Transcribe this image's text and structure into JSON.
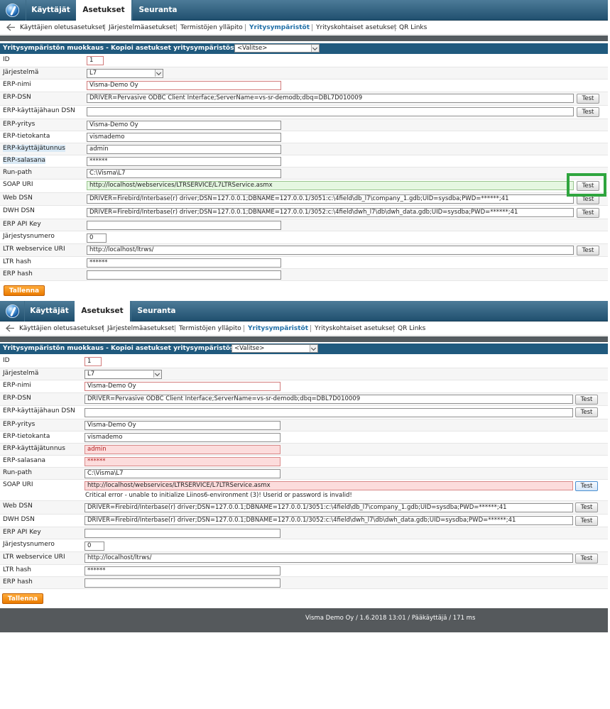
{
  "nav": {
    "tabs": [
      "Käyttäjät",
      "Asetukset",
      "Seuranta"
    ],
    "active_tab": "Asetukset"
  },
  "subnav": {
    "items": [
      "Käyttäjien oletusasetukset",
      "Järjestelmäasetukset",
      "Termistöjen ylläpito",
      "Yritysympäristöt",
      "Yrityskohtaiset asetukset",
      "QR Links"
    ],
    "active": "Yritysympäristöt"
  },
  "form": {
    "header": "Yritysympäristön muokkaus - Kopioi asetukset yritysympäristöstä:",
    "copy_select": "<Valitse>",
    "labels": {
      "id": "ID",
      "jarjestelma": "Järjestelmä",
      "erp_nimi": "ERP-nimi",
      "erp_dsn": "ERP-DSN",
      "erp_kayttajahaun_dsn": "ERP-käyttäjähaun DSN",
      "erp_yritys": "ERP-yritys",
      "erp_tietokanta": "ERP-tietokanta",
      "erp_kayttajatunnus": "ERP-käyttäjätunnus",
      "erp_salasana": "ERP-salasana",
      "run_path": "Run-path",
      "soap_uri": "SOAP URI",
      "web_dsn": "Web DSN",
      "dwh_dsn": "DWH DSN",
      "erp_api_key": "ERP API Key",
      "jarjestysnumero": "Järjestysnumero",
      "ltr_webservice_uri": "LTR webservice URI",
      "ltr_hash": "LTR hash",
      "erp_hash": "ERP hash"
    },
    "values": {
      "id": "1",
      "jarjestelma": "L7",
      "erp_nimi": "Visma-Demo Oy",
      "erp_dsn": "DRIVER=Pervasive ODBC Client Interface;ServerName=vs-sr-demodb;dbq=DBL7D010009",
      "erp_kayttajahaun_dsn": "",
      "erp_yritys": "Visma-Demo Oy",
      "erp_tietokanta": "vismademo",
      "erp_kayttajatunnus": "admin",
      "erp_salasana": "******",
      "run_path": "C:\\Visma\\L7",
      "soap_uri": "http://localhost/webservices/LTRSERVICE/L7LTRService.asmx",
      "web_dsn": "DRIVER=Firebird/Interbase(r) driver;DSN=127.0.0.1;DBNAME=127.0.0.1/3051:c:\\4field\\db_l7\\company_1.gdb;UID=sysdba;PWD=******;41",
      "dwh_dsn": "DRIVER=Firebird/Interbase(r) driver;DSN=127.0.0.1;DBNAME=127.0.0.1/3052:c:\\4field\\dwh_l7\\db\\dwh_data.gdb;UID=sysdba;PWD=******;41",
      "erp_api_key": "",
      "jarjestysnumero": "0",
      "ltr_webservice_uri": "http://localhost/ltrws/",
      "ltr_hash": "******",
      "erp_hash": ""
    },
    "test_label": "Test",
    "save_label": "Tallenna",
    "soap_error": "Critical error - unable to initialize Liinos6-environment (3)! Userid or password is invalid!"
  },
  "footer": {
    "text": "Visma Demo Oy / 1.6.2018 13:01 / Pääkäyttäjä / 171 ms"
  },
  "colors": {
    "nav_bg": "#20506f",
    "header_bg": "#205a7e",
    "save_bg": "#ea7a00",
    "success_bg": "#e5f7e1",
    "error_bg": "#fcdcdc",
    "highlight": "#2fa53e"
  }
}
